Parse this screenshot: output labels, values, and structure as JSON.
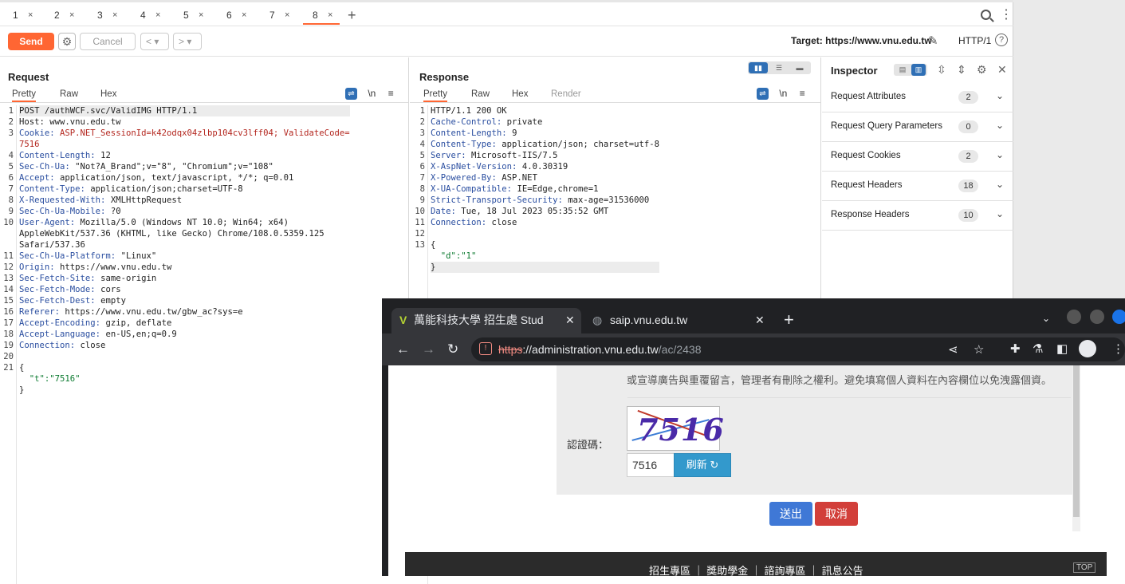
{
  "tabs": [
    "1",
    "2",
    "3",
    "4",
    "5",
    "6",
    "7",
    "8"
  ],
  "tab_close": "×",
  "tab_plus": "+",
  "toolbar": {
    "send": "Send",
    "cancel": "Cancel",
    "prev": "<",
    "prev_dd": "▾",
    "next": ">",
    "next_dd": "▾",
    "target": "Target: https://www.vnu.edu.tw",
    "http": "HTTP/1",
    "help": "?"
  },
  "request": {
    "title": "Request",
    "subtabs": [
      "Pretty",
      "Raw",
      "Hex"
    ],
    "newline": "\\n",
    "menu": "≡"
  },
  "response": {
    "title": "Response",
    "subtabs": [
      "Pretty",
      "Raw",
      "Hex",
      "Render"
    ],
    "newline": "\\n",
    "menu": "≡"
  },
  "request_lines": [
    {
      "n": "1",
      "k": "",
      "v": "POST /authWCF.svc/ValidIMG HTTP/1.1"
    },
    {
      "n": "2",
      "k": "",
      "v": "Host: www.vnu.edu.tw"
    },
    {
      "n": "3",
      "k": "Cookie: ",
      "v": "ASP.NET_SessionId=k42odqx04zlbp104cv3lff04; ValidateCode="
    },
    {
      "n": "",
      "k": "",
      "v": "7516"
    },
    {
      "n": "4",
      "k": "Content-Length: ",
      "v": "12"
    },
    {
      "n": "5",
      "k": "Sec-Ch-Ua: ",
      "v": "\"Not?A_Brand\";v=\"8\", \"Chromium\";v=\"108\""
    },
    {
      "n": "6",
      "k": "Accept: ",
      "v": "application/json, text/javascript, */*; q=0.01"
    },
    {
      "n": "7",
      "k": "Content-Type: ",
      "v": "application/json;charset=UTF-8"
    },
    {
      "n": "8",
      "k": "X-Requested-With: ",
      "v": "XMLHttpRequest"
    },
    {
      "n": "9",
      "k": "Sec-Ch-Ua-Mobile: ",
      "v": "?0"
    },
    {
      "n": "10",
      "k": "User-Agent: ",
      "v": "Mozilla/5.0 (Windows NT 10.0; Win64; x64)"
    },
    {
      "n": "",
      "k": "",
      "v": "AppleWebKit/537.36 (KHTML, like Gecko) Chrome/108.0.5359.125"
    },
    {
      "n": "",
      "k": "",
      "v": "Safari/537.36"
    },
    {
      "n": "11",
      "k": "Sec-Ch-Ua-Platform: ",
      "v": "\"Linux\""
    },
    {
      "n": "12",
      "k": "Origin: ",
      "v": "https://www.vnu.edu.tw"
    },
    {
      "n": "13",
      "k": "Sec-Fetch-Site: ",
      "v": "same-origin"
    },
    {
      "n": "14",
      "k": "Sec-Fetch-Mode: ",
      "v": "cors"
    },
    {
      "n": "15",
      "k": "Sec-Fetch-Dest: ",
      "v": "empty"
    },
    {
      "n": "16",
      "k": "Referer: ",
      "v": "https://www.vnu.edu.tw/gbw_ac?sys=e"
    },
    {
      "n": "17",
      "k": "Accept-Encoding: ",
      "v": "gzip, deflate"
    },
    {
      "n": "18",
      "k": "Accept-Language: ",
      "v": "en-US,en;q=0.9"
    },
    {
      "n": "19",
      "k": "Connection: ",
      "v": "close"
    },
    {
      "n": "20",
      "k": "",
      "v": ""
    },
    {
      "n": "21",
      "k": "",
      "v": "{"
    },
    {
      "n": "",
      "k": "",
      "v": "  \"t\":\"7516\""
    },
    {
      "n": "",
      "k": "",
      "v": "}"
    }
  ],
  "response_lines": [
    {
      "n": "1",
      "k": "",
      "v": "HTTP/1.1 200 OK"
    },
    {
      "n": "2",
      "k": "Cache-Control: ",
      "v": "private"
    },
    {
      "n": "3",
      "k": "Content-Length: ",
      "v": "9"
    },
    {
      "n": "4",
      "k": "Content-Type: ",
      "v": "application/json; charset=utf-8"
    },
    {
      "n": "5",
      "k": "Server: ",
      "v": "Microsoft-IIS/7.5"
    },
    {
      "n": "6",
      "k": "X-AspNet-Version: ",
      "v": "4.0.30319"
    },
    {
      "n": "7",
      "k": "X-Powered-By: ",
      "v": "ASP.NET"
    },
    {
      "n": "8",
      "k": "X-UA-Compatible: ",
      "v": "IE=Edge,chrome=1"
    },
    {
      "n": "9",
      "k": "Strict-Transport-Security: ",
      "v": "max-age=31536000"
    },
    {
      "n": "10",
      "k": "Date: ",
      "v": "Tue, 18 Jul 2023 05:35:52 GMT"
    },
    {
      "n": "11",
      "k": "Connection: ",
      "v": "close"
    },
    {
      "n": "12",
      "k": "",
      "v": ""
    },
    {
      "n": "13",
      "k": "",
      "v": "{"
    },
    {
      "n": "",
      "k": "",
      "v": "  \"d\":\"1\""
    },
    {
      "n": "",
      "k": "",
      "v": "}"
    }
  ],
  "inspector": {
    "title": "Inspector",
    "close": "✕",
    "rows": [
      {
        "label": "Request Attributes",
        "count": "2"
      },
      {
        "label": "Request Query Parameters",
        "count": "0"
      },
      {
        "label": "Request Cookies",
        "count": "2"
      },
      {
        "label": "Request Headers",
        "count": "18"
      },
      {
        "label": "Response Headers",
        "count": "10"
      }
    ]
  },
  "browser": {
    "tab1": "萬能科技大學 招生處 Stud",
    "tab2": "saip.vnu.edu.tw",
    "close": "✕",
    "newtab": "+",
    "url_scheme": "https",
    "url_host": "://administration.vnu.edu.tw",
    "url_path": "/ac/2438",
    "notice": "或宣導廣告與重覆留言，管理者有刪除之權利。避免填寫個人資料在內容欄位以免洩露個資。",
    "captcha_label": "認證碼：",
    "captcha_text": "7516",
    "captcha_value": "7516",
    "refresh": "刷新 ↻",
    "submit": "送出",
    "cancel": "取消",
    "footer": "招生專區 ｜ 獎助學金 ｜ 諮詢專區 ｜ 訊息公告",
    "top": "TOP"
  }
}
